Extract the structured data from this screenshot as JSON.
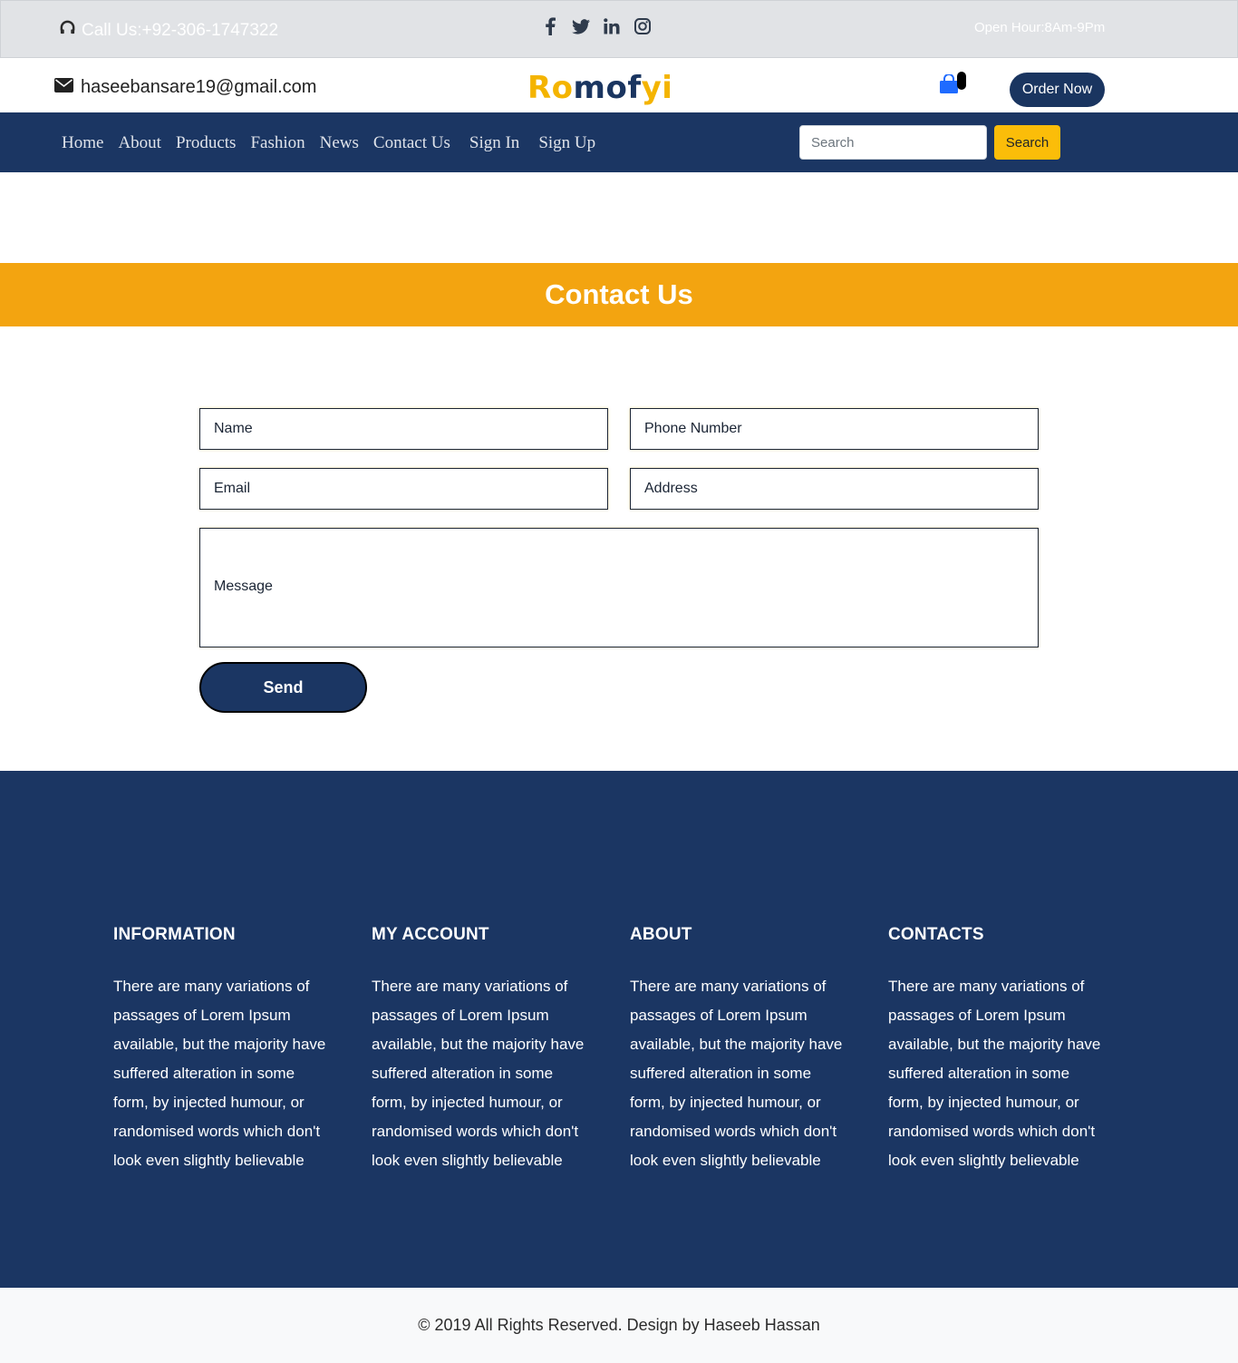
{
  "topbar": {
    "call_text": "Call Us:+92-306-1747322",
    "hours": "Open Hour:8Am-9Pm",
    "socials": [
      "facebook-icon",
      "twitter-icon",
      "linkedin-icon",
      "instagram-icon"
    ]
  },
  "brand": {
    "email": "haseebansare19@gmail.com",
    "logo_part1": "Ro",
    "logo_part2": "mof",
    "logo_part3": "yi",
    "order_label": "Order Now"
  },
  "nav": {
    "items": [
      "Home",
      "About",
      "Products",
      "Fashion",
      "News",
      "Contact Us",
      "Sign In",
      "Sign Up"
    ],
    "search_placeholder": "Search",
    "search_button": "Search"
  },
  "banner": {
    "title": "Contact Us"
  },
  "form": {
    "name_placeholder": "Name",
    "phone_placeholder": "Phone Number",
    "email_placeholder": "Email",
    "address_placeholder": "Address",
    "message_placeholder": "Message",
    "send_label": "Send"
  },
  "footer": {
    "columns": [
      {
        "title": "INFORMATION",
        "text": "There are many variations of passages of Lorem Ipsum available, but the majority have suffered alteration in some form, by injected humour, or randomised words which don't look even slightly believable"
      },
      {
        "title": "MY ACCOUNT",
        "text": "There are many variations of passages of Lorem Ipsum available, but the majority have suffered alteration in some form, by injected humour, or randomised words which don't look even slightly believable"
      },
      {
        "title": "ABOUT",
        "text": "There are many variations of passages of Lorem Ipsum available, but the majority have suffered alteration in some form, by injected humour, or randomised words which don't look even slightly believable"
      },
      {
        "title": "CONTACTS",
        "text": "There are many variations of passages of Lorem Ipsum available, but the majority have suffered alteration in some form, by injected humour, or randomised words which don't look even slightly believable"
      }
    ],
    "copyright": "© 2019 All Rights Reserved. Design by Haseeb Hassan"
  },
  "colors": {
    "navy": "#1b3663",
    "orange": "#f3a410",
    "yellow_button": "#fbbd09",
    "cart_blue": "#1f6bff"
  }
}
